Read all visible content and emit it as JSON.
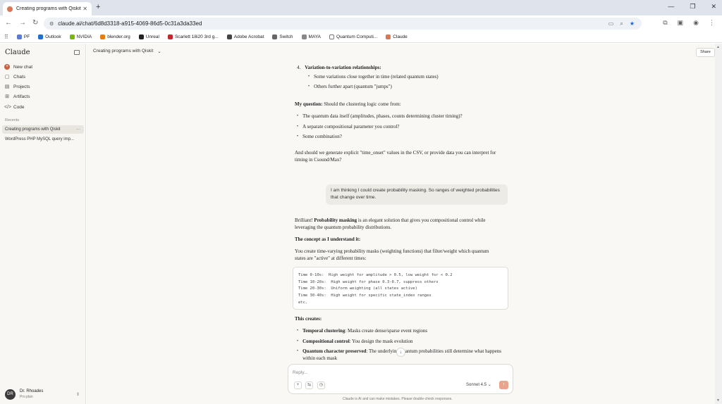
{
  "browser": {
    "tab_title": "Creating programs with Qiskit",
    "url": "claude.ai/chat/6d8d3318-a915-4069-86d5-0c31a3da33ed",
    "bookmarks": [
      {
        "label": "PF",
        "color": "#5b7bd5"
      },
      {
        "label": "Outlook",
        "color": "#1f6fd1"
      },
      {
        "label": "NVIDIA",
        "color": "#76b900"
      },
      {
        "label": "blender.org",
        "color": "#e87d0d"
      },
      {
        "label": "Unreal",
        "color": "#222222"
      },
      {
        "label": "Scarlett 18i20 3rd g...",
        "color": "#c1272d"
      },
      {
        "label": "Adobe Acrobat",
        "color": "#444444"
      },
      {
        "label": "Switch",
        "color": "#666666"
      },
      {
        "label": "MAYA",
        "color": "#888888"
      },
      {
        "label": "Quantum Computi...",
        "color": "#ffffff"
      },
      {
        "label": "Claude",
        "color": "#d97757"
      }
    ]
  },
  "sidebar": {
    "brand": "Claude",
    "nav": [
      {
        "label": "New chat",
        "icon": "plus-icon"
      },
      {
        "label": "Chats",
        "icon": "chat-icon"
      },
      {
        "label": "Projects",
        "icon": "folder-icon"
      },
      {
        "label": "Artifacts",
        "icon": "artifacts-icon"
      },
      {
        "label": "Code",
        "icon": "code-icon"
      }
    ],
    "recents_label": "Recents",
    "recents": [
      {
        "label": "Creating programs with Qiskit"
      },
      {
        "label": "WordPress PHP MySQL query imp..."
      }
    ],
    "user": {
      "initials": "DR",
      "name": "Dr. Rhoades",
      "plan": "Pro plan"
    }
  },
  "header": {
    "chat_title": "Creating programs with Qiskit",
    "share_label": "Share"
  },
  "conversation": {
    "item4_num": "4.",
    "item4_title": "Variation-to-variation relationships:",
    "item4_bullets": [
      "Some variations close together in time (related quantum states)",
      "Others further apart (quantum \"jumps\")"
    ],
    "question_label": "My question:",
    "question_text": " Should the clustering logic come from:",
    "question_bullets": [
      "The quantum data itself (amplitudes, phases, counts determining cluster timing)?",
      "A separate compositional parameter you control?",
      "Some combination?"
    ],
    "followup": "And should we generate explicit \"time_onset\" values in the CSV, or provide data you can interpret for timing in Csound/Max?",
    "user_message": "I am thinking I could create probability masking. So ranges of weighted probabilities that change over time.",
    "reply_intro_a": "Brilliant! ",
    "reply_intro_b": "Probability masking",
    "reply_intro_c": " is an elegant solution that gives you compositional control while leveraging the quantum probability distributions.",
    "concept_heading": "The concept as I understand it:",
    "concept_text": "You create time-varying probability masks (weighting functions) that filter/weight which quantum states are \"active\" at different times:",
    "code_lines": [
      "Time 0-10s:  High weight for amplitude > 0.5, low weight for < 0.2",
      "Time 10-20s:  High weight for phase 0.3-0.7, suppress others",
      "Time 20-30s:  Uniform weighting (all states active)",
      "Time 30-40s:  High weight for specific state_index ranges",
      "etc."
    ],
    "creates_heading": "This creates:",
    "creates_bullets": [
      {
        "label": "Temporal clustering",
        "text": ": Masks create dense/sparse event regions"
      },
      {
        "label": "Compositional control",
        "text": ": You design the mask evolution"
      },
      {
        "label": "Quantum character preserved",
        "text": ": The underlying quantum probabilities still determine what happens within each mask"
      }
    ]
  },
  "composer": {
    "placeholder": "Reply...",
    "model": "Sonnet 4.5",
    "disclaimer": "Claude is AI and can make mistakes. Please double-check responses."
  }
}
